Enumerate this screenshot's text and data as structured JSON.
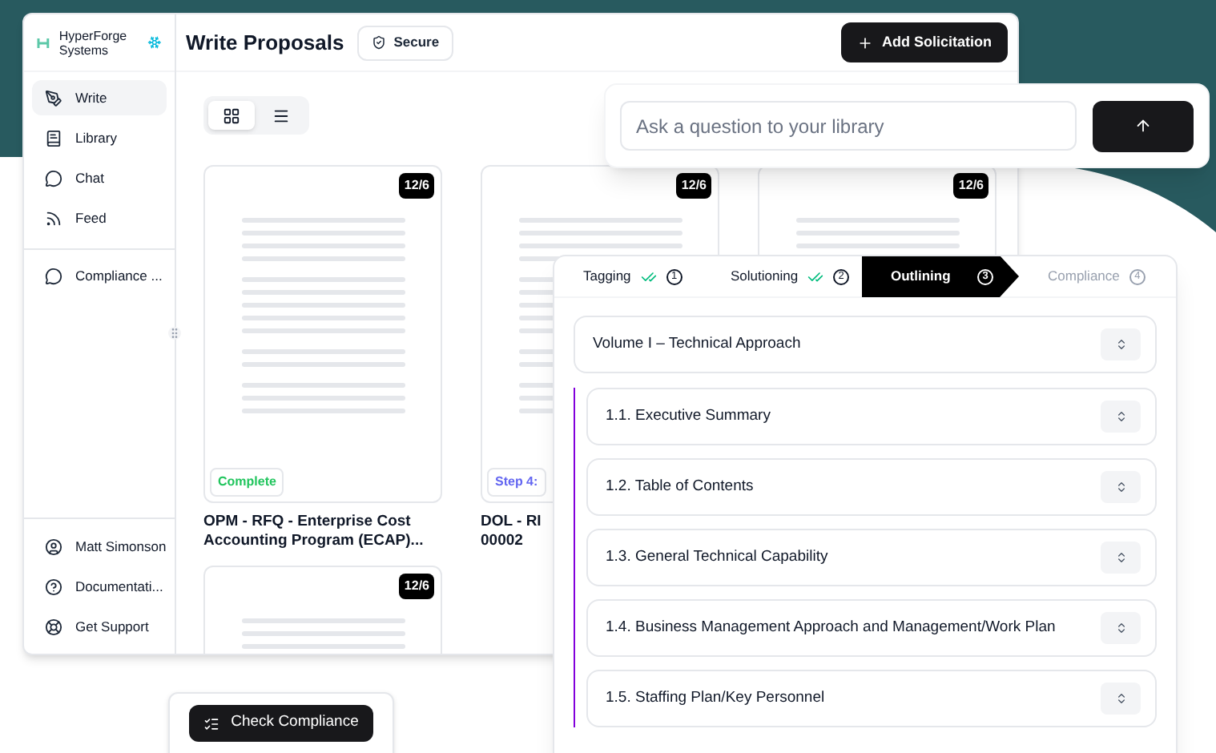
{
  "brand": {
    "name": "HyperForge Systems"
  },
  "sidebar": {
    "items": [
      {
        "label": "Write",
        "selected": true
      },
      {
        "label": "Library",
        "selected": false
      },
      {
        "label": "Chat",
        "selected": false
      },
      {
        "label": "Feed",
        "selected": false
      }
    ],
    "pinned": [
      {
        "label": "Compliance ..."
      }
    ],
    "footer": [
      {
        "label": "Matt Simonson"
      },
      {
        "label": "Documentati..."
      },
      {
        "label": "Get Support"
      }
    ]
  },
  "header": {
    "title": "Write Proposals",
    "badge": "Secure",
    "action": "Add Solicitation"
  },
  "view_toggle": [
    {
      "kind": "grid",
      "selected": true
    },
    {
      "kind": "list",
      "selected": false
    }
  ],
  "cards": [
    {
      "count": "12/6",
      "status": "Complete",
      "color": "#22c55e",
      "title_lines": [
        "OPM - RFQ - Enterprise Cost",
        "Accounting Program (ECAP)..."
      ]
    },
    {
      "count": "12/6",
      "status": "Step 4:",
      "color": "#6366f1",
      "title_lines": [
        "DOL - RI",
        "00002"
      ]
    },
    {
      "count": "12/6"
    },
    {
      "count": "12/6"
    }
  ],
  "search": {
    "placeholder": "Ask a question to your library"
  },
  "steps": [
    {
      "label": "Tagging",
      "number": "1",
      "done": true,
      "selected": false
    },
    {
      "label": "Solutioning",
      "number": "2",
      "done": true,
      "selected": false
    },
    {
      "label": "Outlining",
      "number": "3",
      "done": false,
      "selected": true
    },
    {
      "label": "Compliance",
      "number": "4",
      "done": false,
      "selected": false
    }
  ],
  "outline": {
    "title": "Volume I – Technical Approach",
    "children": [
      {
        "title": "1.1. Executive Summary"
      },
      {
        "title": "1.2. Table of Contents"
      },
      {
        "title": "1.3. General Technical Capability"
      },
      {
        "title": "1.4. Business Management Approach and Management/Work Plan"
      },
      {
        "title": "1.5. Staffing Plan/Key Personnel"
      }
    ]
  },
  "compliance_button": {
    "label": "Check Compliance"
  }
}
